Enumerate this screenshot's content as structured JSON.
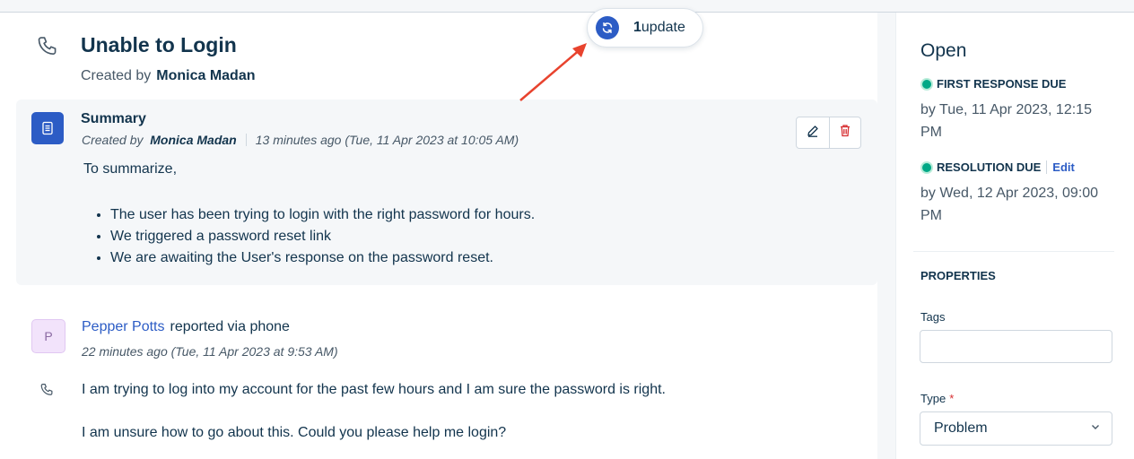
{
  "update_banner": {
    "count": "1",
    "label": "update"
  },
  "ticket": {
    "title": "Unable to Login",
    "created_by_label": "Created by",
    "created_by_name": "Monica Madan"
  },
  "summary": {
    "title": "Summary",
    "created_by_label": "Created by",
    "created_by_name": "Monica Madan",
    "time": "13 minutes ago (Tue, 11 Apr 2023 at 10:05 AM)",
    "intro": "To summarize,",
    "bullets": [
      "The user has been trying to login with the right password for hours.",
      "We triggered a password reset link",
      "We are awaiting the User's response on the password reset."
    ]
  },
  "conversation": {
    "avatar_initial": "P",
    "reporter_name": "Pepper Potts",
    "reported_via": "reported via phone",
    "time": "22 minutes ago (Tue, 11 Apr 2023 at 9:53 AM)",
    "message_line1": "I am trying to log into my account for the past few hours and I am sure the password is right.",
    "message_line2": "I am unsure how to go about this. Could you please help me login?"
  },
  "sidebar": {
    "status": "Open",
    "first_response_label": "FIRST RESPONSE DUE",
    "first_response_value": "by Tue, 11 Apr 2023, 12:15 PM",
    "resolution_label": "RESOLUTION DUE",
    "resolution_edit": "Edit",
    "resolution_value": "by Wed, 12 Apr 2023, 09:00 PM",
    "properties_title": "PROPERTIES",
    "tags_label": "Tags",
    "tags_value": "",
    "type_label": "Type",
    "type_required": "*",
    "type_value": "Problem"
  },
  "colors": {
    "accent": "#2c5cc5",
    "text": "#12344d",
    "muted": "#475867",
    "success": "#00a886",
    "danger": "#d72d30",
    "annotation_arrow": "#e8432e"
  },
  "icons": [
    "phone-icon",
    "document-icon",
    "sync-icon",
    "pencil-icon",
    "trash-icon",
    "chevron-down-icon"
  ]
}
